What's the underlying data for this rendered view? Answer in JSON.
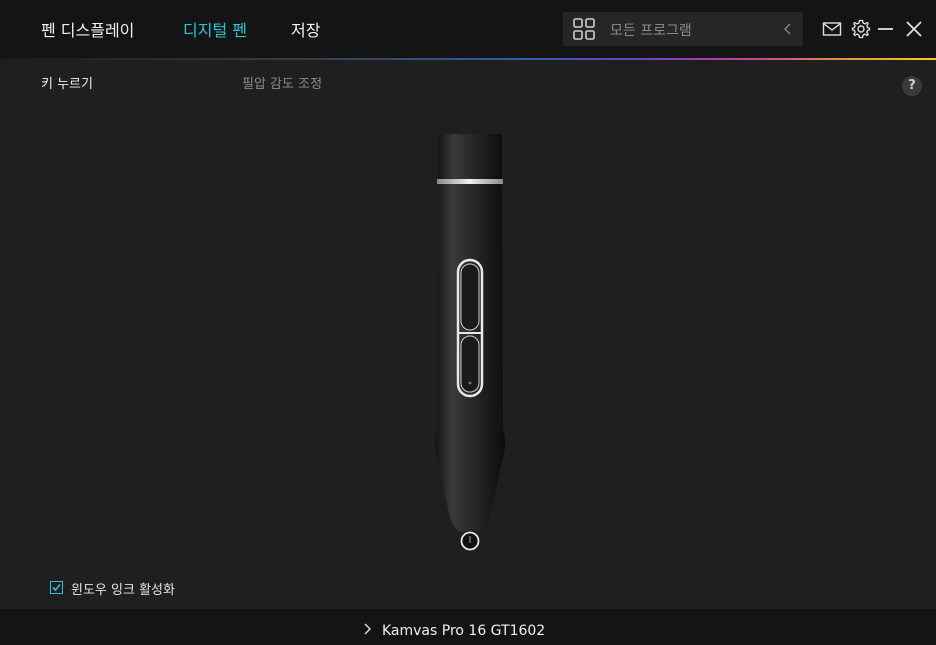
{
  "nav": {
    "tabs": [
      {
        "label": "펜 디스플레이"
      },
      {
        "label": "디지털 펜"
      },
      {
        "label": "저장"
      }
    ],
    "active_tab_index": 1
  },
  "program_selector": {
    "label": "모든 프로그램",
    "icon": "grid-icon"
  },
  "window_controls": {
    "icons": [
      "mail-icon",
      "gear-icon",
      "minimize-icon",
      "close-icon"
    ]
  },
  "subtabs": [
    {
      "label": "키 누르기",
      "active": true
    },
    {
      "label": "필압 감도 조정",
      "active": false
    }
  ],
  "help": {
    "label": "?"
  },
  "windows_ink": {
    "label": "윈도우 잉크 활성화",
    "checked": true
  },
  "device": {
    "name": "Kamvas Pro 16 GT1602"
  },
  "colors": {
    "accent": "#2cc3d8",
    "background": "#1f1f1f",
    "topbar": "#141414"
  }
}
